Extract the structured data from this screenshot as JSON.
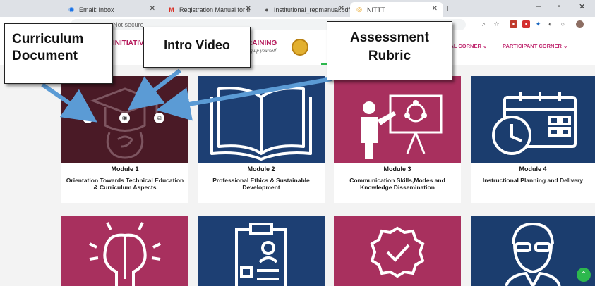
{
  "browser": {
    "tabs": [
      {
        "title": "Email: Inbox",
        "icon": "email-icon"
      },
      {
        "title": "Registration Manual for Institutio",
        "icon": "gmail-icon"
      },
      {
        "title": "Institutional_regmanual.pdf",
        "icon": "globe-icon"
      },
      {
        "title": "NITTT",
        "icon": "nittt-icon"
      }
    ],
    "address_prefix": "Not secure"
  },
  "header": {
    "brand_left": "INITIATIV",
    "brand_right": "RAINING",
    "brand_tagline": "Equip yourself",
    "nav": [
      "NAL CORNER ⌄",
      "PARTICIPANT CORNER ⌄"
    ]
  },
  "modules": [
    {
      "number": "Module 1",
      "title": "Orientation Towards Technical Education & Curriculum Aspects",
      "bg": "#4a1a26",
      "icon": "graduation-brain-icon"
    },
    {
      "number": "Module 2",
      "title": "Professional Ethics & Sustainable Development",
      "bg": "#1d3f73",
      "icon": "open-book-icon"
    },
    {
      "number": "Module 3",
      "title": "Communication Skills,Modes and Knowledge Dissemination",
      "bg": "#a8305e",
      "icon": "presentation-icon"
    },
    {
      "number": "Module 4",
      "title": "Instructional Planning and Delivery",
      "bg": "#1b3d6e",
      "icon": "calendar-clock-icon"
    }
  ],
  "modules_row2": [
    {
      "bg": "#a8305e",
      "icon": "brain-icon"
    },
    {
      "bg": "#1d3f73",
      "icon": "clipboard-icon"
    },
    {
      "bg": "#a8305e",
      "icon": "award-icon"
    },
    {
      "bg": "#1b3d6e",
      "icon": "person-icon"
    }
  ],
  "callouts": {
    "curriculum": "Curriculum Document",
    "intro": "Intro Video",
    "assessment": "Assessment Rubric"
  },
  "colors": {
    "accent": "#b5185a",
    "arrow": "#5b9bd5"
  }
}
